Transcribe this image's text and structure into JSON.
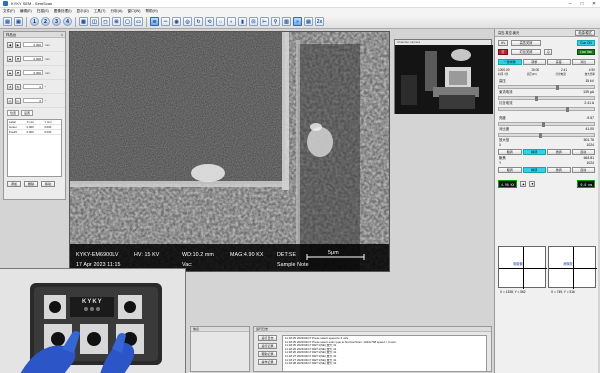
{
  "window": {
    "title": "KYKY SEM - SemScan",
    "controls": [
      "–",
      "□",
      "✕"
    ]
  },
  "menu": [
    "文件(F)",
    "编辑(E)",
    "扫描(S)",
    "图像处理(I)",
    "显示(D)",
    "工具(T)",
    "分析(A)",
    "窗口(W)",
    "帮助(H)"
  ],
  "toolbar": {
    "circle_buttons": [
      "1",
      "2",
      "3",
      "4"
    ],
    "zoom_label": "2x"
  },
  "stage_panel": {
    "title": "样品台",
    "rows": [
      {
        "value": "0.000",
        "unit": "mm"
      },
      {
        "value": "0.000",
        "unit": "mm"
      },
      {
        "value": "0.000",
        "unit": "mm"
      },
      {
        "value": "0",
        "unit": "°"
      },
      {
        "value": "0",
        "unit": "°"
      }
    ],
    "tabs": [
      "位置",
      "设置"
    ],
    "table_header": [
      "Label",
      "X mm",
      "Y mm"
    ],
    "table_rows": [
      [
        "center",
        "0.000",
        "0.000"
      ],
      [
        "Pos#1",
        "0.000",
        "0.000"
      ]
    ],
    "buttons": [
      "添加",
      "删除",
      "移动"
    ]
  },
  "sem_image": {
    "instrument": "KYKY-EM6900LV",
    "hv": "HV: 15 KV",
    "wd": "WD:10.2 mm",
    "mag": "MAG:4.90 KX",
    "det": "DET:SE",
    "scale": "5μm",
    "date": "17 Apr 2023 11:15",
    "vac": "Vac:",
    "sample": "Sample Note"
  },
  "chamber_view": {
    "title": "Chamber camera"
  },
  "right_panel": {
    "header": "高压-真空-聚光",
    "top_button": "电源/模式",
    "btn_hv": "HV",
    "btn_hv_state": "高压关闭",
    "btn_cyan": "Gun ON",
    "btn_filament": "灯丝",
    "btn_fil_state": "灯丝关闭",
    "btn_q": "Q",
    "btn_green": "Low Vac",
    "tabs_row": [
      "一键成像",
      "调整",
      "亮度",
      "对比"
    ],
    "stats_values": [
      "1000.00",
      "15.00",
      "2.41",
      "4.90"
    ],
    "stats_labels": [
      "时间 / 秒",
      "高压(kV)",
      "灯丝电流",
      "放大倍率"
    ],
    "params": [
      {
        "label": "高压",
        "value": "15 kV"
      },
      {
        "label": "束流电流",
        "value": "139 μA"
      },
      {
        "label": "灯丝电流",
        "value": "2.41 A"
      }
    ],
    "sec2": [
      {
        "label": "亮度",
        "value": "-9.57"
      },
      {
        "label": "对比度",
        "value": "41.00"
      },
      {
        "label": "放大倍",
        "value": "501.76"
      },
      {
        "label": "X",
        "value": "1024"
      },
      {
        "label": "聚焦",
        "value": "663.81"
      },
      {
        "label": "Y",
        "value": "1024"
      }
    ],
    "seg1": [
      "粗调",
      "精调",
      "微调",
      "自动"
    ],
    "seg2": [
      "粗调",
      "精调",
      "微调",
      "自动"
    ],
    "lcd": "4.90 KX",
    "lcd2": "0.0 nm",
    "plot_left_label": "电磁偏",
    "plot_right_label": "消像散",
    "coord_left": "X = 1338, Y = 562",
    "coord_right": "X = 749, Y = 516"
  },
  "log_panel": {
    "title": "运行日志",
    "buttons": [
      "运行日志",
      "运行记录",
      "帮助记录",
      "操作记录"
    ],
    "lines": [
      "11:18:25 2023/04/17 Press select speed to 3 us/s",
      "11:18:25 2023/04/17 Press select scan type to Normal Scan: 1024x768 speed = 3 us/s",
      "11:18:25 2023/04/17 DET:1(SE) 放大 41",
      "11:18:26 2023/04/17 DET:1(SE) 放大 41",
      "11:18:26 2023/04/17 DET:1(SE) 放大 41",
      "11:18:27 2023/04/17 DET:1(SE) 放大 41",
      "11:18:27 2023/04/17 DET:1(SE) 放大 41",
      "11:18:28 2023/04/17 DET:1(SE) 放大 41"
    ]
  },
  "left_bottom_panel": {
    "title": "信息"
  },
  "controller": {
    "brand": "KYKY"
  }
}
